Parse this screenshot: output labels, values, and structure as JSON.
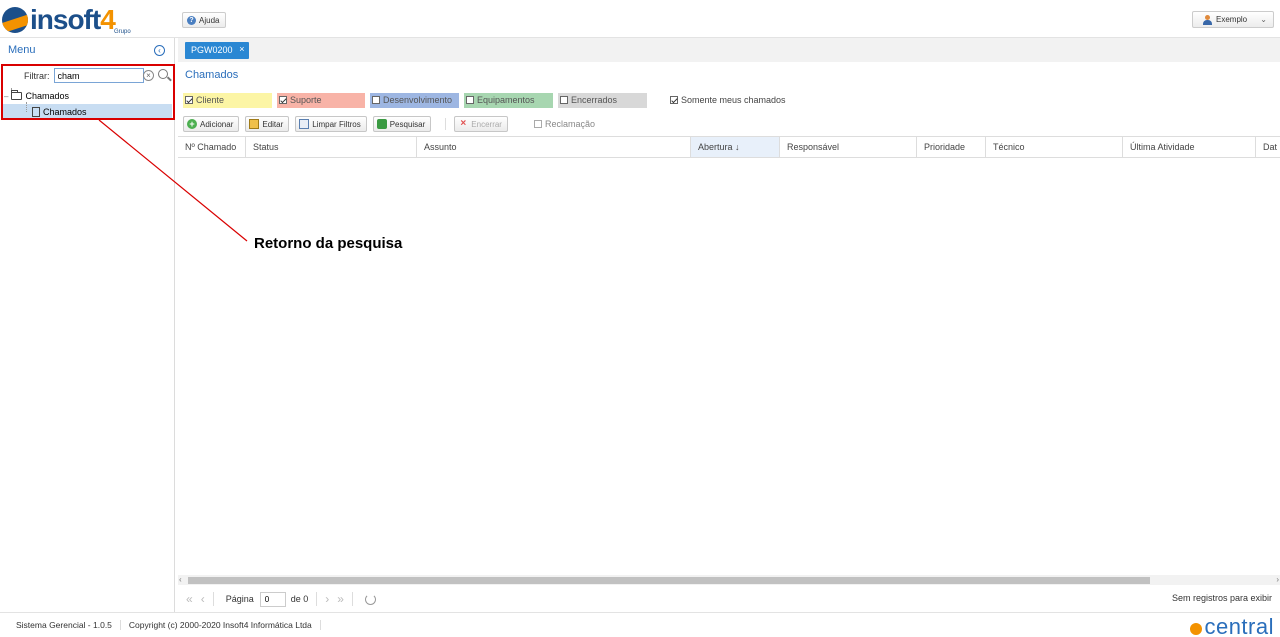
{
  "header": {
    "logo_text_a": "insoft",
    "logo_text_b": "4",
    "logo_sub": "Grupo",
    "help_label": "Ajuda",
    "user_label": "Exemplo"
  },
  "sidebar": {
    "title": "Menu",
    "filter_label": "Filtrar:",
    "filter_value": "cham",
    "tree": {
      "folder_label": "Chamados",
      "item_label": "Chamados"
    }
  },
  "main": {
    "tab_label": "PGW0200",
    "page_title": "Chamados",
    "legend": [
      {
        "label": "Cliente",
        "checked": true,
        "color": "#fcf5a5"
      },
      {
        "label": "Suporte",
        "checked": true,
        "color": "#f8b3a7"
      },
      {
        "label": "Desenvolvimento",
        "checked": false,
        "color": "#9db6e2"
      },
      {
        "label": "Equipamentos",
        "checked": false,
        "color": "#a7d6b0"
      },
      {
        "label": "Encerrados",
        "checked": false,
        "color": "#d8d8d8"
      }
    ],
    "only_mine_label": "Somente meus chamados",
    "toolbar": {
      "add": "Adicionar",
      "edit": "Editar",
      "clear_filters": "Limpar Filtros",
      "search": "Pesquisar",
      "close": "Encerrar",
      "complaint": "Reclamação"
    },
    "columns": [
      {
        "label": "Nº Chamado"
      },
      {
        "label": "Status"
      },
      {
        "label": "Assunto"
      },
      {
        "label": "Abertura ↓"
      },
      {
        "label": "Responsável"
      },
      {
        "label": "Prioridade"
      },
      {
        "label": "Técnico"
      },
      {
        "label": "Última Atividade"
      },
      {
        "label": "Dat"
      }
    ],
    "pager": {
      "page_label": "Página",
      "page_value": "0",
      "of_label": "de 0",
      "info": "Sem registros para exibir"
    }
  },
  "footer": {
    "version": "Sistema Gerencial - 1.0.5",
    "copyright": "Copyright (c) 2000-2020 Insoft4 Informática Ltda",
    "central_logo": "central"
  },
  "annotation": {
    "text": "Retorno da pesquisa",
    "color": "#d90000"
  }
}
